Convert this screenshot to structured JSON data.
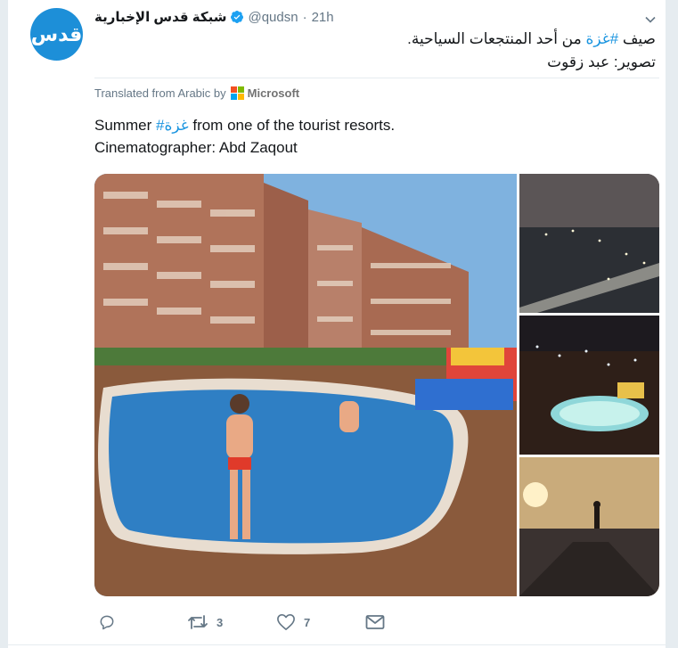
{
  "tweet": {
    "avatar_text": "قدس",
    "author_name": "شبكة قدس الإخبارية",
    "handle": "@qudsn",
    "separator": "·",
    "time": "21h",
    "arabic_line1_before": "صيف ",
    "arabic_hashtag": "#غزة",
    "arabic_line1_after": " من أحد المنتجعات السياحية.",
    "arabic_line2": "تصوير: عبد زقوت",
    "translated_label": "Translated from Arabic by",
    "translator": "Microsoft",
    "english_line1_before": "Summer ",
    "english_hashtag": "#غزة",
    "english_line1_after": " from one of the tourist resorts.",
    "english_line2": "Cinematographer: Abd Zaqout"
  },
  "actions": {
    "reply_count": "",
    "retweet_count": "3",
    "like_count": "7"
  },
  "icons": {
    "verified": "verified-badge-icon",
    "menu": "chevron-down-icon",
    "reply": "reply-icon",
    "retweet": "retweet-icon",
    "like": "heart-icon",
    "dm": "envelope-icon"
  },
  "colors": {
    "accent": "#1b95e0",
    "avatar_bg": "#1d8fd8",
    "muted": "#657786",
    "text": "#14171a"
  }
}
